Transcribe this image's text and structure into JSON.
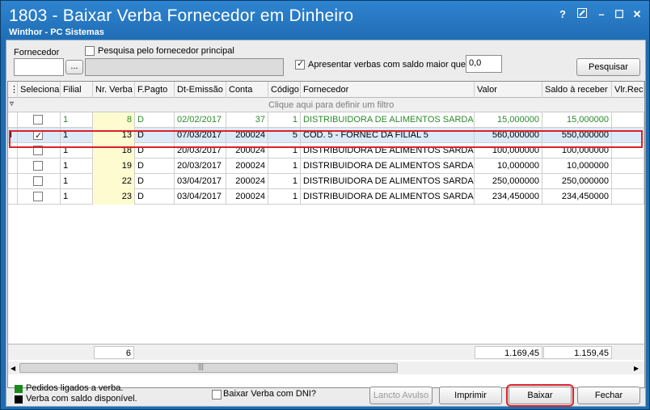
{
  "window": {
    "title": "1803 - Baixar Verba Fornecedor em Dinheiro",
    "subtitle": "Winthor - PC Sistemas",
    "help_glyph": "?",
    "min_glyph": "–",
    "max_glyph": "☐",
    "close_glyph": "✕"
  },
  "filters": {
    "fornecedor_label": "Fornecedor",
    "fornecedor_value": "",
    "browse_label": "...",
    "pesquisa_principal_label": "Pesquisa pelo fornecedor principal",
    "apresentar_label": "Apresentar verbas com saldo maior que",
    "saldo_value": "0,0",
    "pesquisar_label": "Pesquisar"
  },
  "grid": {
    "headers": [
      "Selecionar",
      "Filial",
      "Nr. Verba",
      "F.Pagto",
      "Dt-Emissão",
      "Conta",
      "Código",
      "Fornecedor",
      "Valor",
      "Saldo à receber",
      "Vlr.Rece"
    ],
    "filter_hint": "Clique aqui para definir um filtro",
    "rows": [
      {
        "checked": false,
        "filial": "1",
        "nr_verba": "8",
        "fpagto": "D",
        "dt": "02/02/2017",
        "conta": "37",
        "codigo": "1",
        "fornecedor": "DISTRIBUIDORA DE ALIMENTOS SARDAGNA",
        "valor": "15,000000",
        "saldo": "15,000000",
        "green": true
      },
      {
        "checked": true,
        "filial": "1",
        "nr_verba": "13",
        "fpagto": "D",
        "dt": "07/03/2017",
        "conta": "200024",
        "codigo": "5",
        "fornecedor": "COD. 5 - FORNEC DA FILIAL 5",
        "valor": "560,000000",
        "saldo": "550,000000",
        "green": false
      },
      {
        "checked": false,
        "filial": "1",
        "nr_verba": "18",
        "fpagto": "D",
        "dt": "20/03/2017",
        "conta": "200024",
        "codigo": "1",
        "fornecedor": "DISTRIBUIDORA DE ALIMENTOS SARDAGNA",
        "valor": "100,000000",
        "saldo": "100,000000",
        "green": false
      },
      {
        "checked": false,
        "filial": "1",
        "nr_verba": "19",
        "fpagto": "D",
        "dt": "20/03/2017",
        "conta": "200024",
        "codigo": "1",
        "fornecedor": "DISTRIBUIDORA DE ALIMENTOS SARDAGNA",
        "valor": "10,000000",
        "saldo": "10,000000",
        "green": false
      },
      {
        "checked": false,
        "filial": "1",
        "nr_verba": "22",
        "fpagto": "D",
        "dt": "03/04/2017",
        "conta": "200024",
        "codigo": "1",
        "fornecedor": "DISTRIBUIDORA DE ALIMENTOS SARDAGNA",
        "valor": "250,000000",
        "saldo": "250,000000",
        "green": false
      },
      {
        "checked": false,
        "filial": "1",
        "nr_verba": "23",
        "fpagto": "D",
        "dt": "03/04/2017",
        "conta": "200024",
        "codigo": "1",
        "fornecedor": "DISTRIBUIDORA DE ALIMENTOS SARDAGNA",
        "valor": "234,450000",
        "saldo": "234,450000",
        "green": false
      }
    ],
    "footer_count": "6",
    "footer_valor": "1.169,45",
    "footer_saldo": "1.159,45",
    "row_indicator": "I",
    "filter_icon": "▿",
    "hscroll_grip": "|||"
  },
  "legend": {
    "pedidos": "Pedidos ligados a verba.",
    "saldo": "Verba com saldo disponível.",
    "pedidos_color": "#1a8a1a",
    "saldo_color": "#000000"
  },
  "actions": {
    "dni_label": "Baixar Verba com DNI?",
    "lancto_label": "Lancto Avulso",
    "imprimir_label": "Imprimir",
    "baixar_label": "Baixar",
    "fechar_label": "Fechar"
  },
  "colors": {
    "title_bg": "#1f6db5",
    "highlight": "#d8232a",
    "nr_verba_bg": "#fffbd0",
    "selected_row_bg": "#dce9f7"
  }
}
